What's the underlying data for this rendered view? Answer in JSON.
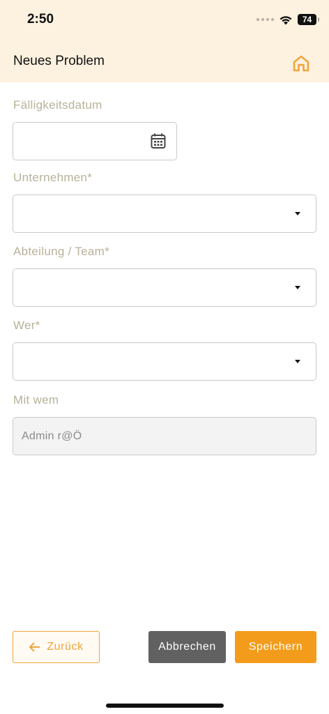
{
  "status_bar": {
    "time": "2:50",
    "battery": "74",
    "icons": [
      "signal-dots-icon",
      "wifi-icon",
      "battery-icon"
    ]
  },
  "header": {
    "title": "Neues Problem",
    "home_icon": "home-icon",
    "accent_color": "#f0a53d",
    "background_color": "#fdf1df"
  },
  "form": {
    "due_date": {
      "label": "Fälligkeitsdatum",
      "value": "",
      "icon": "calendar-icon"
    },
    "company": {
      "label": "Unternehmen*",
      "value": ""
    },
    "department": {
      "label": "Abteilung / Team*",
      "value": ""
    },
    "who": {
      "label": "Wer*",
      "value": ""
    },
    "with_whom": {
      "label": "Mit wem",
      "value": "Admin r@Ö"
    }
  },
  "footer": {
    "back_label": "Zurück",
    "cancel_label": "Abbrechen",
    "save_label": "Speichern",
    "save_color": "#f39c1c",
    "cancel_color": "#616161"
  }
}
